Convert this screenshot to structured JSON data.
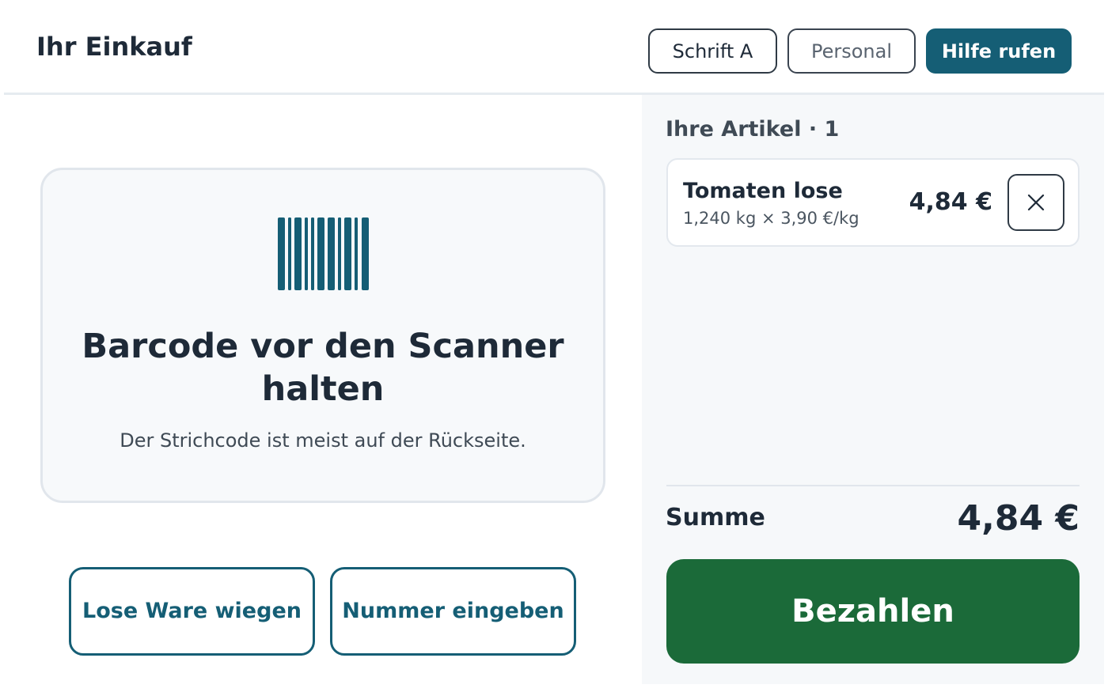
{
  "header": {
    "title": "Ihr Einkauf",
    "font_button": "Schrift A",
    "staff_button": "Personal",
    "help_button": "Hilfe rufen"
  },
  "scan": {
    "title": "Barcode vor den Scanner halten",
    "subtitle": "Der Strichcode ist meist auf der Rückseite.",
    "icon": "barcode-icon"
  },
  "actions": {
    "weigh_label": "Lose Ware wiegen",
    "number_label": "Nummer eingeben"
  },
  "cart": {
    "title": "Ihre Artikel · 1",
    "items": [
      {
        "name": "Tomaten lose",
        "detail": "1,240 kg × 3,90 €/kg",
        "price": "4,84 €"
      }
    ],
    "sum_label": "Summe",
    "sum_value": "4,84 €",
    "pay_label": "Bezahlen"
  },
  "colors": {
    "accent": "#155e75",
    "pay": "#1b6a39",
    "text": "#1e2a38"
  }
}
